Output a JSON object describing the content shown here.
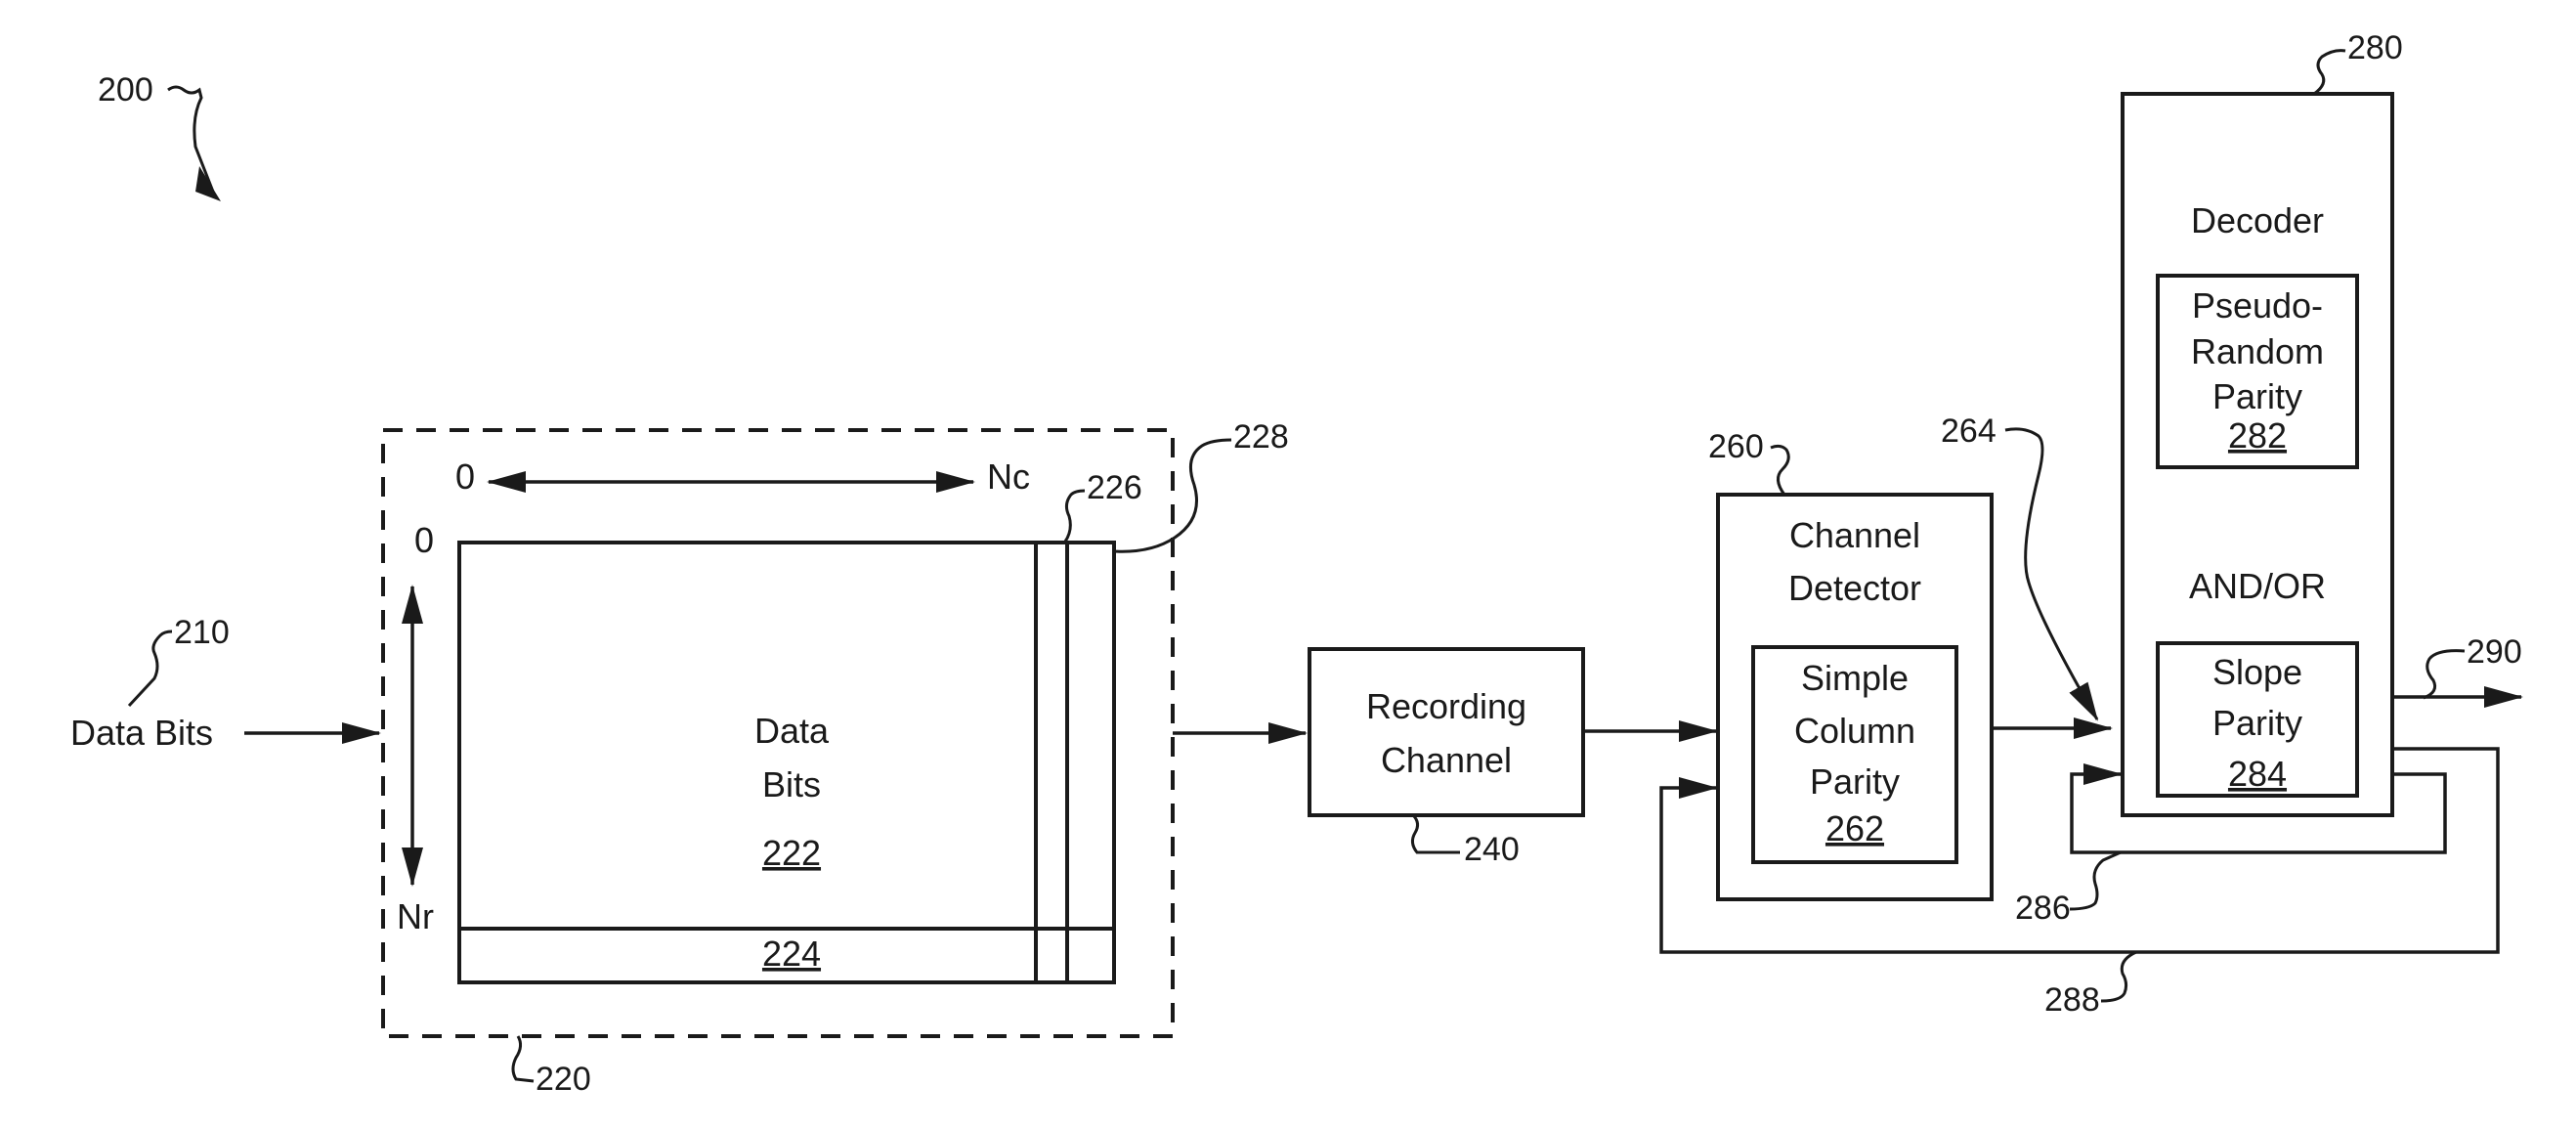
{
  "figure": {
    "ref": "200"
  },
  "input": {
    "label": "Data Bits",
    "ref": "210"
  },
  "encoder_block": {
    "ref": "220",
    "col_axis_start": "0",
    "col_axis_end": "Nc",
    "row_axis_start": "0",
    "row_axis_end": "Nr",
    "data_region": {
      "line1": "Data",
      "line2": "Bits",
      "ref": "222"
    },
    "row_parity_ref": "224",
    "column_parity_ref_1": "226",
    "column_parity_ref_2": "228"
  },
  "recording_channel": {
    "line1": "Recording",
    "line2": "Channel",
    "ref": "240"
  },
  "channel_detector": {
    "ref": "260",
    "line1": "Channel",
    "line2": "Detector",
    "inner": {
      "line1": "Simple",
      "line2": "Column",
      "line3": "Parity",
      "ref": "262"
    }
  },
  "detector_output_ref": "264",
  "decoder": {
    "ref": "280",
    "title": "Decoder",
    "pseudo_random": {
      "line1": "Pseudo-",
      "line2": "Random",
      "line3": "Parity",
      "ref": "282"
    },
    "connector": "AND/OR",
    "slope": {
      "line1": "Slope",
      "line2": "Parity",
      "ref": "284"
    }
  },
  "feedback": {
    "inner_ref": "286",
    "outer_ref": "288"
  },
  "output_ref": "290"
}
